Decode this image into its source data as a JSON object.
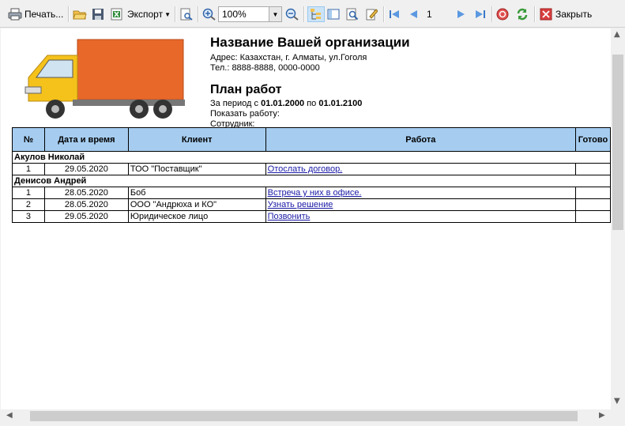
{
  "toolbar": {
    "print_label": "Печать...",
    "export_label": "Экспорт",
    "zoom_value": "100%",
    "page_number": "1",
    "close_label": "Закрыть"
  },
  "report": {
    "org_name": "Название Вашей организации",
    "address": "Адрес: Казахстан, г. Алматы, ул.Гоголя",
    "phone": "Тел.: 8888-8888, 0000-0000",
    "plan_title": "План работ",
    "period_prefix": "За период с",
    "period_from": "01.01.2000",
    "period_mid": "по",
    "period_to": "01.01.2100",
    "show_work": "Показать работу:",
    "employee": "Сотрудник:"
  },
  "table": {
    "headers": [
      "№",
      "Дата и время",
      "Клиент",
      "Работа",
      "Готово"
    ],
    "groups": [
      {
        "name": "Акулов Николай",
        "rows": [
          {
            "num": "1",
            "date": "29.05.2020",
            "client": "ТОО \"Поставщик\"",
            "work": "Отослать договор.",
            "done": ""
          }
        ]
      },
      {
        "name": "Денисов Андрей",
        "rows": [
          {
            "num": "1",
            "date": "28.05.2020",
            "client": "Боб",
            "work": "Встреча у них в офисе.",
            "done": ""
          },
          {
            "num": "2",
            "date": "28.05.2020",
            "client": "ООО \"Андрюха и КО\"",
            "work": "Узнать решение",
            "done": ""
          },
          {
            "num": "3",
            "date": "29.05.2020",
            "client": "Юридическое лицо",
            "work": "Позвонить",
            "done": ""
          }
        ]
      }
    ]
  },
  "colors": {
    "header_bg": "#a6cdf0",
    "truck_cargo": "#e8682a",
    "truck_cab": "#f5c21b",
    "link": "#1a1aa6"
  }
}
